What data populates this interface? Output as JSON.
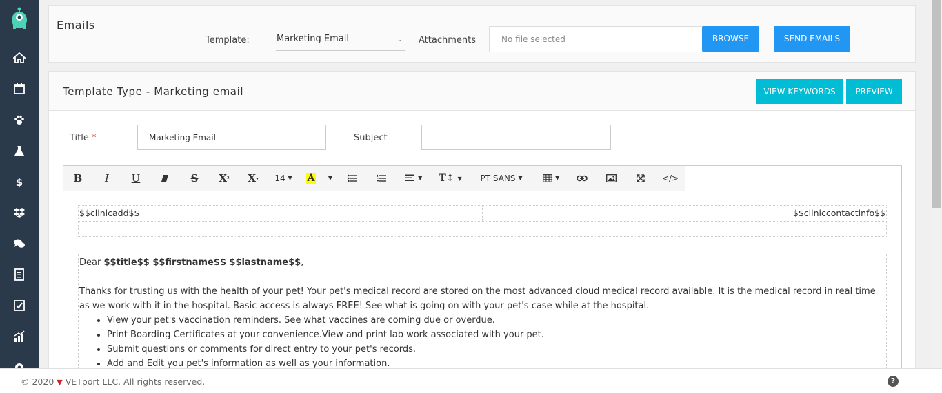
{
  "colors": {
    "sidebar": "#2b3a4a",
    "primary": "#2196f3",
    "accent": "#00bcd4",
    "logo": "#4cd3b5"
  },
  "top_panel": {
    "heading": "Emails",
    "template_label": "Template:",
    "template_value": "Marketing Email",
    "attachments_label": "Attachments",
    "file_placeholder": "No file selected",
    "browse_label": "BROWSE",
    "send_label": "SEND EMAILS"
  },
  "template_panel": {
    "title": "Template Type - Marketing email",
    "view_keywords_label": "VIEW KEYWORDS",
    "preview_label": "PREVIEW",
    "title_label": "Title",
    "required_mark": "*",
    "title_value": "Marketing Email",
    "subject_label": "Subject",
    "subject_value": ""
  },
  "toolbar": {
    "bold": "B",
    "italic": "I",
    "underline": "U",
    "strike": "S",
    "superscript": "X",
    "sup_mark": "²",
    "subscript": "X",
    "sub_mark": "₂",
    "font_size": "14",
    "font_color": "A",
    "line_height": "T↕",
    "font_family": "PT SANS",
    "code_view": "</>"
  },
  "editor": {
    "clinic_addr": "$$clinicadd$$",
    "clinic_contact": "$$cliniccontactinfo$$",
    "greeting_prefix": "Dear",
    "greeting_vars": "$$title$$ $$firstname$$ $$lastname$$",
    "greeting_suffix": ",",
    "paragraph": "Thanks for trusting us with the health of your pet! Your pet's medical record are stored on the most advanced cloud medical record available. It is the medical record in real time as we work with it in the hospital. Basic access is always FREE! See what is going on with your pet's case while at the hospital.",
    "bullets": [
      "View your pet's vaccination reminders.  See what vaccines are coming due or overdue.",
      "Print Boarding Certificates at your convenience.View and print lab work associated with your pet.",
      "Submit questions or comments for direct entry to your pet's records.",
      "Add and Edit you pet's information as well as your information."
    ]
  },
  "footer": {
    "copyright_prefix": "© 2020",
    "brand": "VETport LLC. All rights reserved.",
    "help": "?"
  }
}
